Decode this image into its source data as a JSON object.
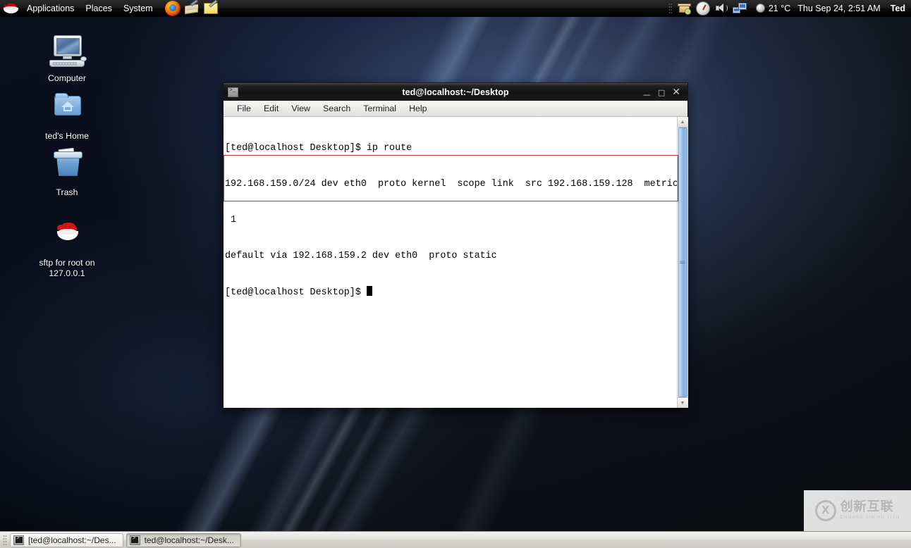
{
  "top_panel": {
    "logo_icon": "redhat-logo-icon",
    "menus": [
      {
        "label": "Applications",
        "name": "menu-applications"
      },
      {
        "label": "Places",
        "name": "menu-places"
      },
      {
        "label": "System",
        "name": "menu-system"
      }
    ],
    "launchers": [
      {
        "name": "firefox-launcher-icon",
        "icon": "firefox-icon"
      },
      {
        "name": "evolution-mail-launcher-icon",
        "icon": "mail-icon"
      },
      {
        "name": "text-editor-launcher-icon",
        "icon": "editor-icon"
      }
    ],
    "tray": [
      {
        "name": "package-updater-icon"
      },
      {
        "name": "power-gauge-icon"
      },
      {
        "name": "volume-icon"
      },
      {
        "name": "network-icon"
      }
    ],
    "weather": "21 °C",
    "clock": "Thu Sep 24,  2:51 AM",
    "user": "Ted"
  },
  "desktop_icons": [
    {
      "name": "desktop-icon-computer",
      "label": "Computer"
    },
    {
      "name": "desktop-icon-home",
      "label": "ted's Home"
    },
    {
      "name": "desktop-icon-trash",
      "label": "Trash"
    },
    {
      "name": "desktop-icon-sftp",
      "label": "sftp for root on 127.0.0.1"
    }
  ],
  "terminal": {
    "title": "ted@localhost:~/Desktop",
    "window_buttons": {
      "minimize": "—",
      "maximize": "□",
      "close": "✕"
    },
    "menus": [
      {
        "label": "File",
        "name": "terminal-menu-file"
      },
      {
        "label": "Edit",
        "name": "terminal-menu-edit"
      },
      {
        "label": "View",
        "name": "terminal-menu-view"
      },
      {
        "label": "Search",
        "name": "terminal-menu-search"
      },
      {
        "label": "Terminal",
        "name": "terminal-menu-terminal"
      },
      {
        "label": "Help",
        "name": "terminal-menu-help"
      }
    ],
    "lines": [
      "[ted@localhost Desktop]$ ip route",
      "192.168.159.0/24 dev eth0  proto kernel  scope link  src 192.168.159.128  metric",
      " 1",
      "default via 192.168.159.2 dev eth0  proto static",
      "[ted@localhost Desktop]$ "
    ],
    "prompt_text": "[ted@localhost Desktop]$ ",
    "annotation_color": "#c0392b"
  },
  "taskbar": {
    "buttons": [
      {
        "label": "[ted@localhost:~/Des...",
        "state": "inactive",
        "name": "taskbar-button-1"
      },
      {
        "label": "ted@localhost:~/Desk...",
        "state": "active",
        "name": "taskbar-button-2"
      }
    ]
  },
  "watermark": {
    "cn": "创新互联",
    "en": "CHUANG XIN HU LIAN",
    "logo": "cx-logo-icon"
  }
}
